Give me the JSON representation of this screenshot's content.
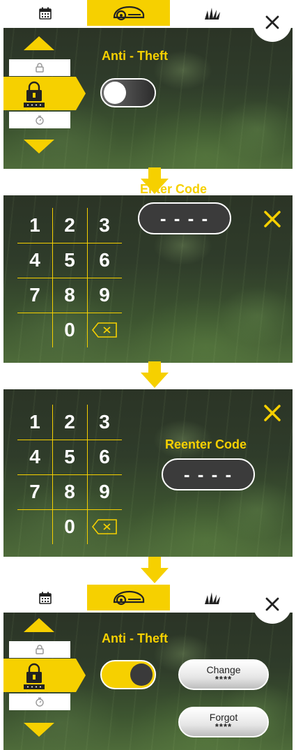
{
  "screens": {
    "anti_theft_off": {
      "title": "Anti - Theft",
      "toggle_state": "off"
    },
    "enter_code": {
      "title": "Enter Code",
      "code_mask": "- - - -"
    },
    "reenter_code": {
      "title": "Reenter Code",
      "code_mask": "- - - -"
    },
    "anti_theft_on": {
      "title": "Anti - Theft",
      "toggle_state": "on",
      "change_button": {
        "label": "Change",
        "mask": "****"
      },
      "forgot_button": {
        "label": "Forgot",
        "mask": "****"
      }
    }
  },
  "keypad": {
    "keys": [
      "1",
      "2",
      "3",
      "4",
      "5",
      "6",
      "7",
      "8",
      "9",
      "0"
    ]
  },
  "tabs": [
    {
      "icon": "calendar-icon",
      "active": false
    },
    {
      "icon": "mower-icon",
      "active": true
    },
    {
      "icon": "grass-icon",
      "active": false
    }
  ],
  "menu_icons": [
    "lock-icon",
    "pin-lock-icon",
    "timer-icon"
  ],
  "colors": {
    "accent": "#f6d000",
    "dark": "#3b3b3b",
    "white": "#ffffff"
  }
}
